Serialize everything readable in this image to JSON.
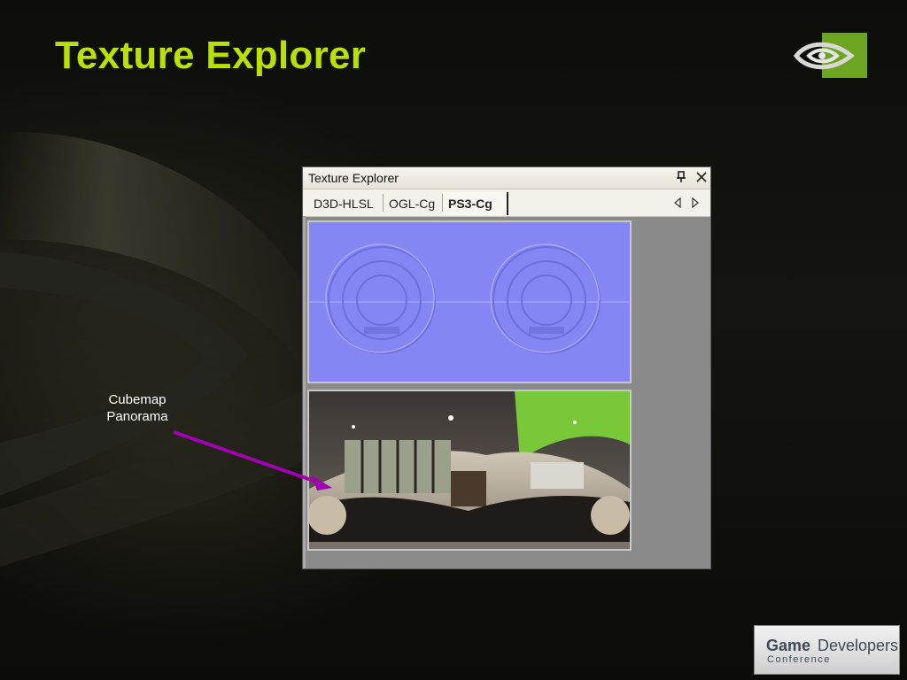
{
  "slide": {
    "title": "Texture Explorer",
    "title_color": "#b8e000"
  },
  "window": {
    "title": "Texture Explorer",
    "pin_icon": "pin-icon",
    "close_icon": "close-icon",
    "tabs": [
      {
        "label": "D3D-HLSL",
        "active": false
      },
      {
        "label": "OGL-Cg",
        "active": false
      },
      {
        "label": "PS3-Cg",
        "active": true
      }
    ],
    "nav": {
      "left_icon": "arrow-left-icon",
      "right_icon": "arrow-right-icon"
    },
    "textures": [
      {
        "kind": "normal-map",
        "color": "#8080f2"
      },
      {
        "kind": "cubemap-panorama",
        "color": "#2a2622"
      }
    ]
  },
  "annotation": {
    "line1": "Cubemap",
    "line2": "Panorama",
    "arrow_color": "#a000b0"
  },
  "branding": {
    "vendor_logo": "eye-logo",
    "logo_color": "#6ea520",
    "conference_game": "Game",
    "conference_developers": "Developers",
    "conference_sub": "Conference"
  }
}
